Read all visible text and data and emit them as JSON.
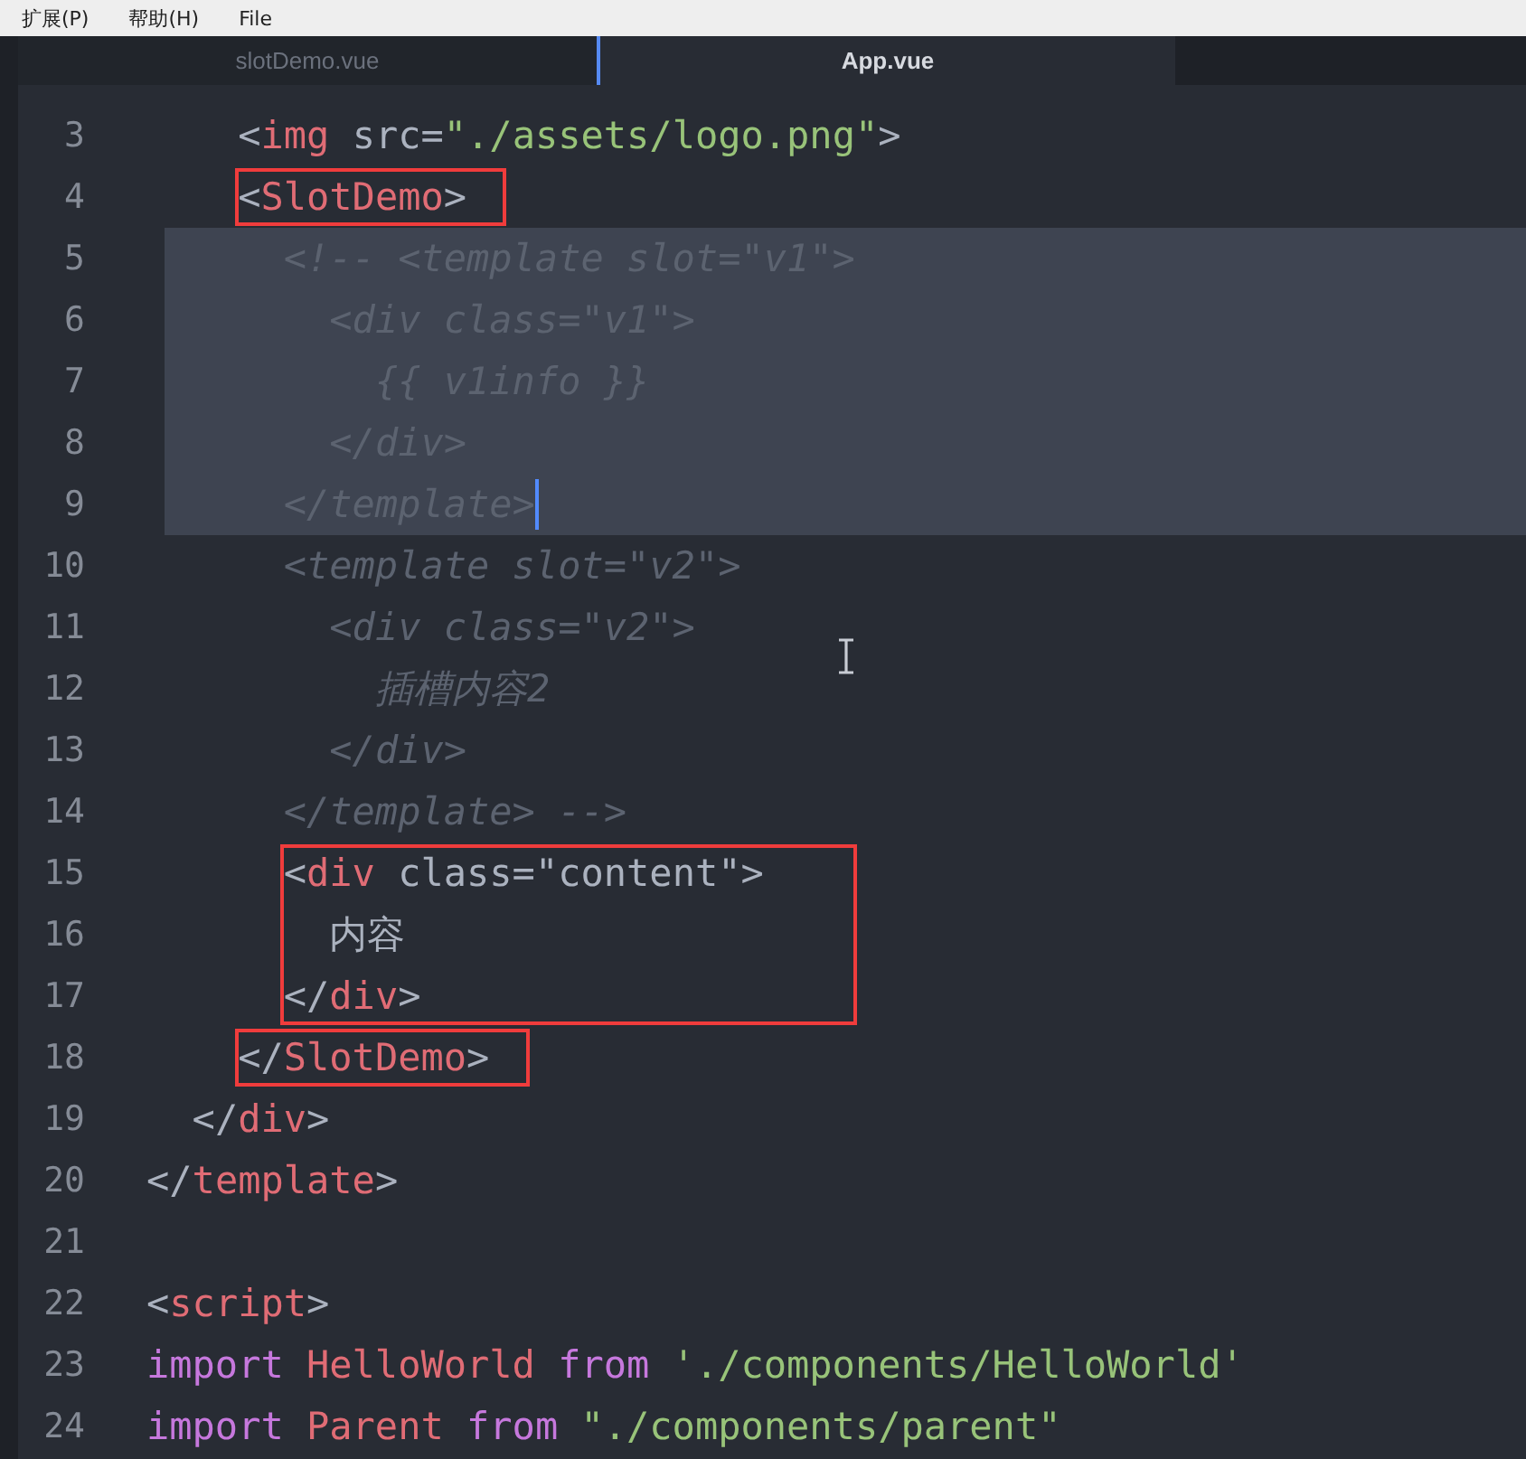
{
  "menu_bar": [
    "扩展(P)",
    "帮助(H)",
    "File"
  ],
  "tabs": [
    {
      "label": "slotDemo.vue",
      "selected": false
    },
    {
      "label": "App.vue",
      "selected": true
    }
  ],
  "editor": {
    "lines": [
      {
        "number": "3",
        "selected": false,
        "tokens": [
          {
            "kind": "punct",
            "text": "    <"
          },
          {
            "kind": "tag",
            "text": "img"
          },
          {
            "kind": "attr",
            "text": " src="
          },
          {
            "kind": "string",
            "text": "\"./assets/logo.png\""
          },
          {
            "kind": "punct",
            "text": ">"
          }
        ]
      },
      {
        "number": "4",
        "selected": false,
        "frame_top": true,
        "tokens": [
          {
            "kind": "punct",
            "text": "    <"
          },
          {
            "kind": "tag",
            "text": "SlotDemo"
          },
          {
            "kind": "punct",
            "text": ">"
          }
        ]
      },
      {
        "number": "5",
        "selected": true,
        "tokens": [
          {
            "kind": "comment",
            "text": "      <!-- <template slot=\"v1\">"
          }
        ]
      },
      {
        "number": "6",
        "selected": true,
        "tokens": [
          {
            "kind": "comment",
            "text": "        <div class=\"v1\">"
          }
        ]
      },
      {
        "number": "7",
        "selected": true,
        "tokens": [
          {
            "kind": "comment",
            "text": "          {{ v1info }}"
          }
        ]
      },
      {
        "number": "8",
        "selected": true,
        "tokens": [
          {
            "kind": "comment",
            "text": "        </div>"
          }
        ]
      },
      {
        "number": "9",
        "selected": true,
        "cursor": true,
        "tokens": [
          {
            "kind": "comment",
            "text": "      </template>"
          }
        ]
      },
      {
        "number": "10",
        "selected": false,
        "tokens": [
          {
            "kind": "comment",
            "text": "      <template slot=\"v2\">"
          }
        ]
      },
      {
        "number": "11",
        "selected": false,
        "tokens": [
          {
            "kind": "comment",
            "text": "        <div class=\"v2\">"
          }
        ]
      },
      {
        "number": "12",
        "selected": false,
        "tokens": [
          {
            "kind": "comment",
            "text": "          插槽内容2"
          }
        ]
      },
      {
        "number": "13",
        "selected": false,
        "tokens": [
          {
            "kind": "comment",
            "text": "        </div>"
          }
        ]
      },
      {
        "number": "14",
        "selected": false,
        "tokens": [
          {
            "kind": "comment",
            "text": "      </template> -->"
          }
        ]
      },
      {
        "number": "15",
        "selected": false,
        "frame_top": true,
        "tokens": [
          {
            "kind": "punct",
            "text": "      <"
          },
          {
            "kind": "tag",
            "text": "div"
          },
          {
            "kind": "attr",
            "text": " class="
          },
          {
            "kind": "plainstr",
            "text": "\"content\""
          },
          {
            "kind": "punct",
            "text": ">"
          }
        ]
      },
      {
        "number": "16",
        "selected": false,
        "frame_top": false,
        "tokens": [
          {
            "kind": "plain",
            "text": "        内容"
          }
        ]
      },
      {
        "number": "17",
        "selected": false,
        "frame_top": false,
        "tokens": [
          {
            "kind": "punct",
            "text": "      </"
          },
          {
            "kind": "tag",
            "text": "div"
          },
          {
            "kind": "punct",
            "text": ">"
          }
        ]
      },
      {
        "number": "18",
        "selected": false,
        "frame_top": true,
        "tokens": [
          {
            "kind": "punct",
            "text": "    </"
          },
          {
            "kind": "tag",
            "text": "SlotDemo"
          },
          {
            "kind": "punct",
            "text": ">"
          }
        ]
      },
      {
        "number": "19",
        "selected": false,
        "tokens": [
          {
            "kind": "punct",
            "text": "  </"
          },
          {
            "kind": "tag",
            "text": "div"
          },
          {
            "kind": "punct",
            "text": ">"
          }
        ]
      },
      {
        "number": "20",
        "selected": false,
        "tokens": [
          {
            "kind": "punct",
            "text": "</"
          },
          {
            "kind": "tag",
            "text": "template"
          },
          {
            "kind": "punct",
            "text": ">"
          }
        ]
      },
      {
        "number": "21",
        "selected": false
      },
      {
        "number": "22",
        "selected": false,
        "tokens": [
          {
            "kind": "punct",
            "text": "<"
          },
          {
            "kind": "tag",
            "text": "script"
          },
          {
            "kind": "punct",
            "text": ">"
          }
        ]
      },
      {
        "number": "23",
        "selected": false,
        "tokens": [
          {
            "kind": "keyword",
            "text": "import"
          },
          {
            "kind": "tag",
            "text": " HelloWorld"
          },
          {
            "kind": "keyword",
            "text": " from"
          },
          {
            "kind": "string",
            "text": " './components/HelloWorld'"
          }
        ]
      },
      {
        "number": "24",
        "selected": false,
        "tokens": [
          {
            "kind": "keyword",
            "text": "import"
          },
          {
            "kind": "tag",
            "text": " Parent"
          },
          {
            "kind": "keyword",
            "text": " from"
          },
          {
            "kind": "string",
            "text": " \"./components/parent\""
          }
        ]
      }
    ]
  }
}
